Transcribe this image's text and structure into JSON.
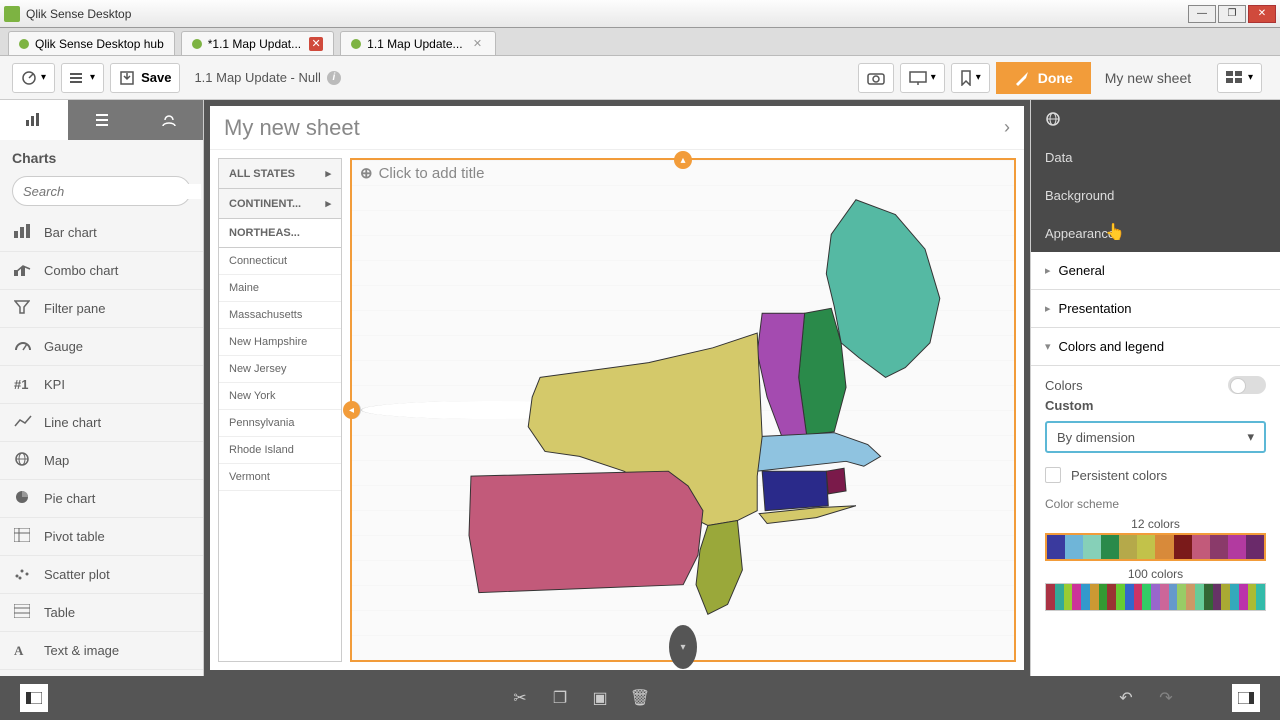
{
  "window": {
    "title": "Qlik Sense Desktop"
  },
  "tabs": [
    {
      "label": "Qlik Sense Desktop hub",
      "active": false,
      "closeable": false
    },
    {
      "label": "*1.1 Map Updat...",
      "active": true,
      "closeable": true
    },
    {
      "label": "1.1 Map Update...",
      "active": false,
      "closeable": true,
      "closeDisabled": true
    }
  ],
  "toolbar": {
    "save_label": "Save",
    "breadcrumb": "1.1 Map Update - Null",
    "done_label": "Done",
    "sheet_name": "My new sheet"
  },
  "left_panel": {
    "header": "Charts",
    "search_placeholder": "Search",
    "items": [
      "Bar chart",
      "Combo chart",
      "Filter pane",
      "Gauge",
      "KPI",
      "Line chart",
      "Map",
      "Pie chart",
      "Pivot table",
      "Scatter plot",
      "Table",
      "Text & image"
    ]
  },
  "sheet": {
    "title_placeholder": "My new sheet",
    "map_title_placeholder": "Click to add title",
    "filters": {
      "all_states": "ALL STATES",
      "continent": "CONTINENT...",
      "region_header": "NORTHEAS...",
      "states": [
        "Connecticut",
        "Maine",
        "Massachusetts",
        "New Hampshire",
        "New Jersey",
        "New York",
        "Pennsylvania",
        "Rhode Island",
        "Vermont"
      ]
    }
  },
  "right_panel": {
    "data": "Data",
    "background": "Background",
    "appearance": "Appearance",
    "general": "General",
    "presentation": "Presentation",
    "colors_legend": "Colors and legend",
    "colors_label": "Colors",
    "custom_label": "Custom",
    "dropdown_value": "By dimension",
    "persistent": "Persistent colors",
    "scheme_label": "Color scheme",
    "count12": "12 colors",
    "count100": "100 colors"
  },
  "colors12": [
    "#3a3a9e",
    "#6fb5d8",
    "#86d0b8",
    "#2a8a4a",
    "#b5a94a",
    "#c2c24a",
    "#d88a3a",
    "#7a1a1a",
    "#c25a7a",
    "#8a3a6a",
    "#b23aa0",
    "#6a2a6a"
  ],
  "colors100": [
    "#a34",
    "#3a9",
    "#9c3",
    "#c39",
    "#39c",
    "#c93",
    "#393",
    "#933",
    "#6c3",
    "#36c",
    "#c36",
    "#3c6",
    "#96c",
    "#c69",
    "#69c",
    "#9c6",
    "#c96",
    "#6c9",
    "#363",
    "#636",
    "#aa3",
    "#3ab",
    "#b3a",
    "#ab3",
    "#3ba"
  ],
  "chart_data": {
    "type": "map",
    "title": "",
    "dimension": "State",
    "region_filter": "Northeast",
    "color_mode": "By dimension",
    "states": [
      {
        "name": "Maine",
        "color": "#55b9a3"
      },
      {
        "name": "New Hampshire",
        "color": "#2a8a4a"
      },
      {
        "name": "Vermont",
        "color": "#a44bb0"
      },
      {
        "name": "Massachusetts",
        "color": "#8fc3e0"
      },
      {
        "name": "Connecticut",
        "color": "#2a2a8a"
      },
      {
        "name": "Rhode Island",
        "color": "#7a1a4a"
      },
      {
        "name": "New York",
        "color": "#d4c96a"
      },
      {
        "name": "New Jersey",
        "color": "#9aa83a"
      },
      {
        "name": "Pennsylvania",
        "color": "#c25a7a"
      }
    ]
  }
}
